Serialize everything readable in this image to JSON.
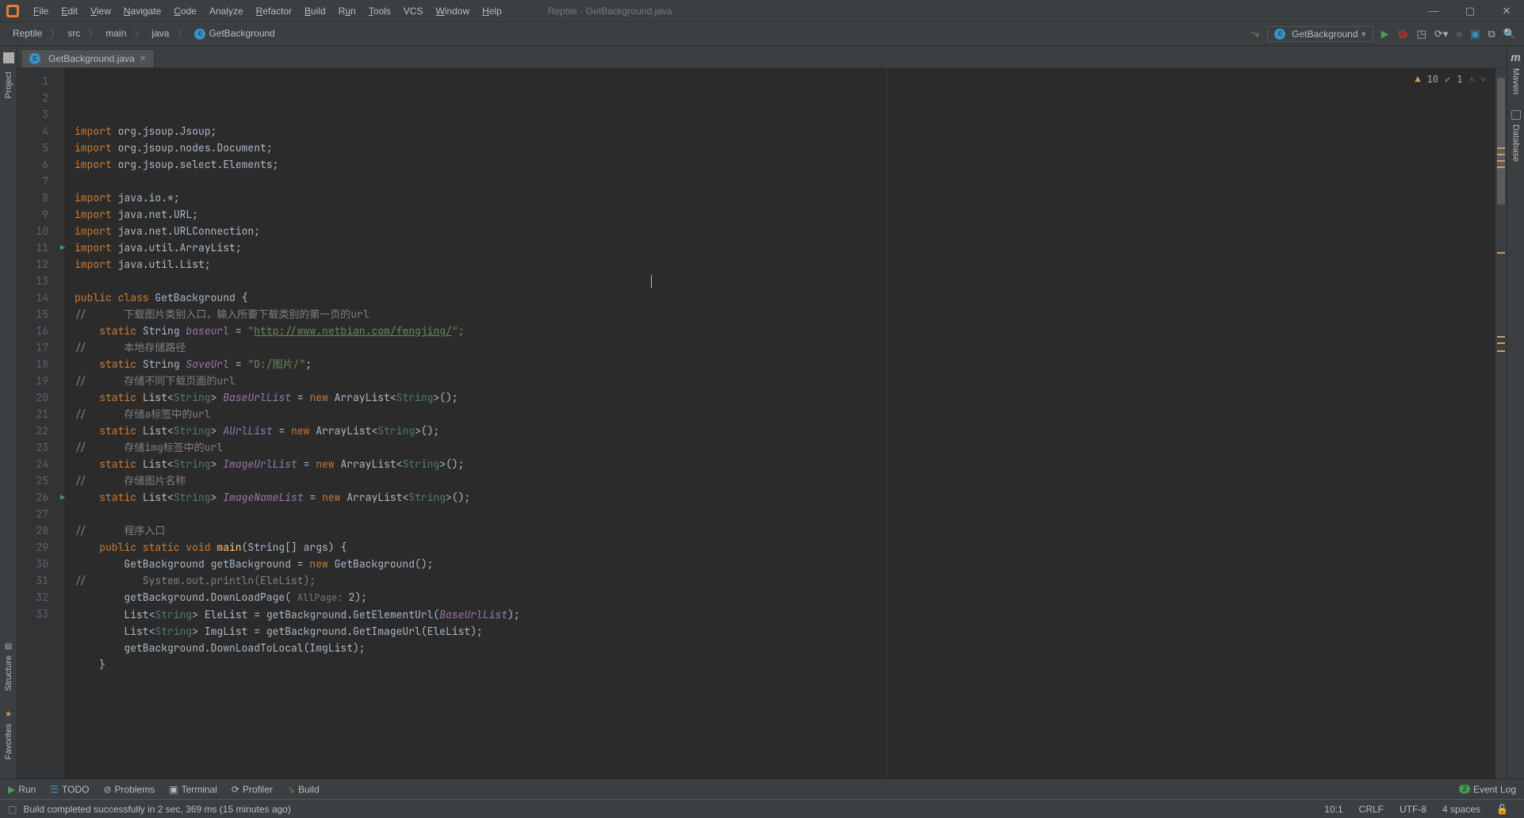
{
  "window": {
    "title": "Reptile - GetBackground.java"
  },
  "menu": {
    "file": "File",
    "edit": "Edit",
    "view": "View",
    "navigate": "Navigate",
    "code": "Code",
    "analyze": "Analyze",
    "refactor": "Refactor",
    "build": "Build",
    "run": "Run",
    "tools": "Tools",
    "vcs": "VCS",
    "window": "Window",
    "help": "Help"
  },
  "breadcrumbs": {
    "root": "Reptile",
    "p1": "src",
    "p2": "main",
    "p3": "java",
    "p4": "GetBackground"
  },
  "runconfig": {
    "name": "GetBackground"
  },
  "tab": {
    "name": "GetBackground.java"
  },
  "leftRail": {
    "project": "Project",
    "structure": "Structure",
    "favorites": "Favorites"
  },
  "rightRail": {
    "maven": "Maven",
    "database": "Database"
  },
  "inspections": {
    "warnings": "10",
    "typos": "1"
  },
  "gutter": {
    "lines": [
      "1",
      "2",
      "3",
      "4",
      "5",
      "6",
      "7",
      "8",
      "9",
      "10",
      "11",
      "12",
      "13",
      "14",
      "15",
      "16",
      "17",
      "18",
      "19",
      "20",
      "21",
      "22",
      "23",
      "24",
      "25",
      "26",
      "27",
      "28",
      "29",
      "30",
      "31",
      "32",
      "33"
    ]
  },
  "code": {
    "l1": {
      "kw": "import",
      "rest": " org.jsoup.Jsoup;"
    },
    "l2": {
      "kw": "import",
      "rest": " org.jsoup.nodes.Document;"
    },
    "l3": {
      "kw": "import",
      "rest": " org.jsoup.select.Elements;"
    },
    "l5": {
      "kw": "import",
      "rest": " java.io.*;"
    },
    "l6": {
      "kw": "import",
      "rest": " java.net.URL;"
    },
    "l7": {
      "kw": "import",
      "rest": " java.net.URLConnection;"
    },
    "l8": {
      "kw": "import",
      "rest": " java.util.ArrayList;"
    },
    "l9": {
      "kw": "import",
      "rest": " java.util.List;"
    },
    "l11": {
      "kw1": "public class",
      "name": " GetBackground ",
      "brace": "{"
    },
    "l12": "//      下载图片类别入口，输入所要下载类别的第一页的url",
    "l13": {
      "kw": "static ",
      "type": "String ",
      "fld": "baseurl",
      "eq": " = ",
      "q1": "\"",
      "url": "http://www.netbian.com/fengjing/",
      "q2": "\";",
      "ind": "    "
    },
    "l14": "//      本地存储路径",
    "l15": {
      "kw": "static ",
      "type": "String ",
      "fld": "SaveUrl",
      "eq": " = ",
      "str": "\"D:/图片/\"",
      "end": ";",
      "ind": "    "
    },
    "l16": "//      存储不同下载页面的url",
    "l17": {
      "kw": "static ",
      "type1": "List<",
      "typ": "String",
      "type2": "> ",
      "fld": "BaseUrlList",
      "eq": " = ",
      "kw2": "new ",
      "ctor": "ArrayList<",
      "typ2": "String",
      "end": ">();",
      "ind": "    "
    },
    "l18": "//      存储a标签中的url",
    "l19": {
      "kw": "static ",
      "type1": "List<",
      "typ": "String",
      "type2": "> ",
      "fld": "AUrlList",
      "eq": " = ",
      "kw2": "new ",
      "ctor": "ArrayList<",
      "typ2": "String",
      "end": ">();",
      "ind": "    "
    },
    "l20": "//      存储img标签中的url",
    "l21": {
      "kw": "static ",
      "type1": "List<",
      "typ": "String",
      "type2": "> ",
      "fld": "ImageUrlList",
      "eq": " = ",
      "kw2": "new ",
      "ctor": "ArrayList<",
      "typ2": "String",
      "end": ">();",
      "ind": "    "
    },
    "l22": "//      存储图片名称",
    "l23": {
      "kw": "static ",
      "type1": "List<",
      "typ": "String",
      "type2": "> ",
      "fld": "ImageNameList",
      "eq": " = ",
      "kw2": "new ",
      "ctor": "ArrayList<",
      "typ2": "String",
      "end": ">();",
      "ind": "    "
    },
    "l25": "//      程序入口",
    "l26": {
      "kw": "public static void ",
      "mtd": "main",
      "sig": "(String[] args) {",
      "ind": "    "
    },
    "l27": {
      "txt1": "GetBackground getBackground = ",
      "kw": "new ",
      "txt2": "GetBackground();",
      "ind": "        "
    },
    "l28": "//         System.out.println(EleList);",
    "l29": {
      "txt1": "getBackground.DownLoadPage( ",
      "hint": "AllPage: ",
      "num": "2",
      "txt2": ");",
      "ind": "        "
    },
    "l30": {
      "txt1": "List<",
      "typ": "String",
      "txt2": "> EleList = getBackground.GetElementUrl(",
      "fld": "BaseUrlList",
      "txt3": ");",
      "ind": "        "
    },
    "l31": {
      "txt1": "List<",
      "typ": "String",
      "txt2": "> ImgList = getBackground.GetImageUrl(EleList);",
      "ind": "        "
    },
    "l32": {
      "txt": "getBackground.DownLoadToLocal(ImgList);",
      "ind": "        "
    },
    "l33": {
      "txt": "}",
      "ind": "    "
    }
  },
  "bottom": {
    "run": "Run",
    "todo": "TODO",
    "problems": "Problems",
    "terminal": "Terminal",
    "profiler": "Profiler",
    "build": "Build",
    "eventlog": "Event Log"
  },
  "status": {
    "msg": "Build completed successfully in 2 sec, 369 ms (15 minutes ago)",
    "pos": "10:1",
    "lineend": "CRLF",
    "enc": "UTF-8",
    "indent": "4 spaces"
  }
}
